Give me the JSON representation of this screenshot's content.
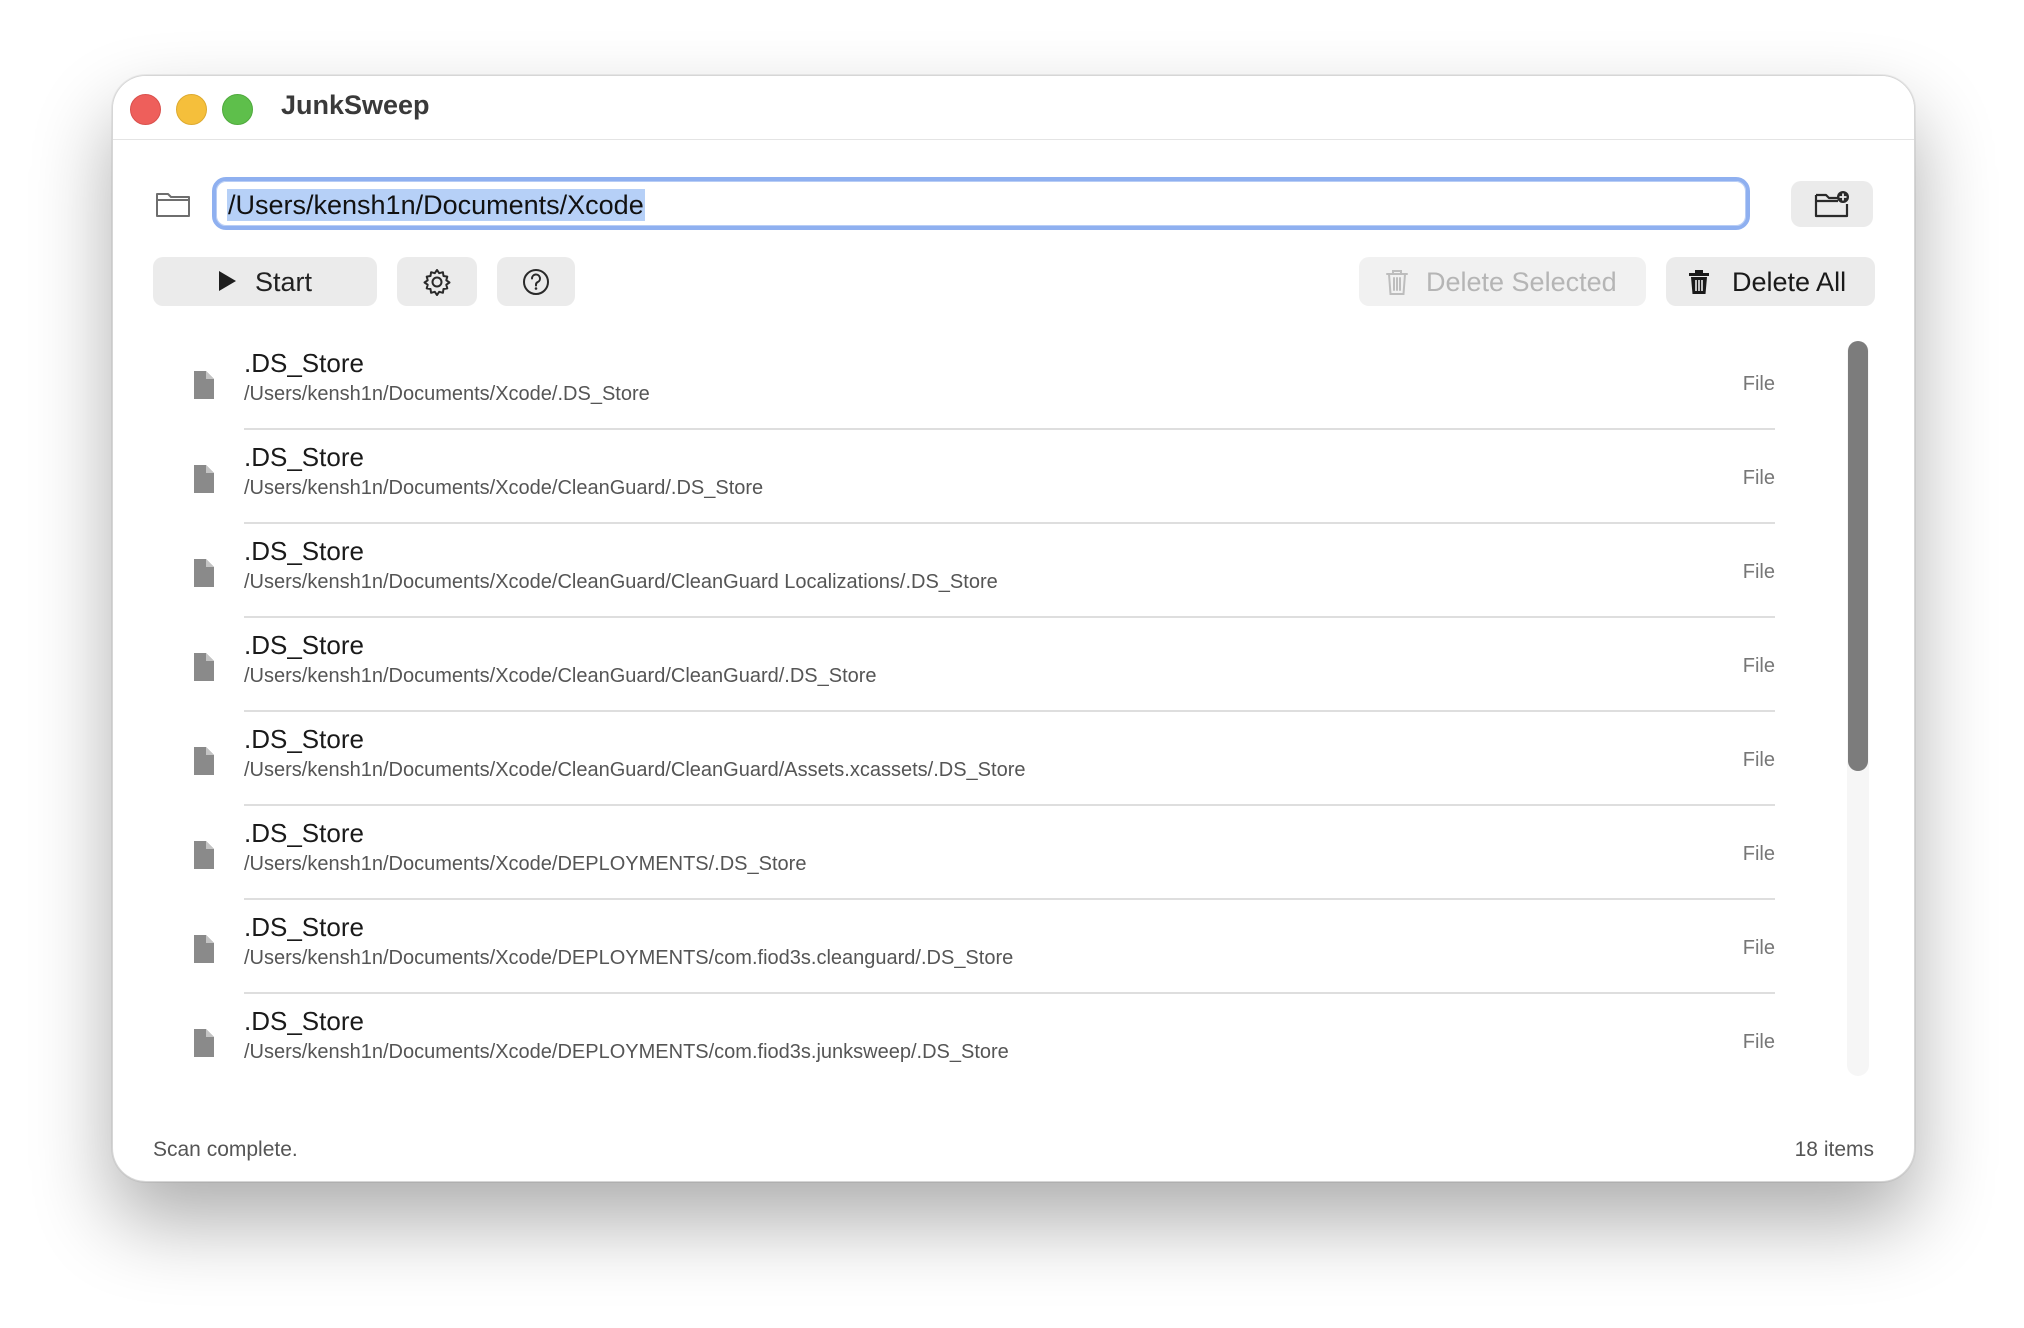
{
  "window": {
    "title": "JunkSweep"
  },
  "path_field": {
    "value": "/Users/kensh1n/Documents/Xcode"
  },
  "toolbar": {
    "start_label": "Start",
    "delete_selected_label": "Delete Selected",
    "delete_all_label": "Delete All"
  },
  "icons": {
    "folder": "folder-icon",
    "choose_folder": "folder-badge-plus-icon",
    "play": "play-icon",
    "settings": "gear-icon",
    "help": "question-circle-icon",
    "delete_selected": "trash-icon",
    "delete_all": "trash-fill-icon",
    "file": "doc-fill-icon"
  },
  "colors": {
    "selection": "#b6d0f7",
    "focus_ring": "#8fb0f0",
    "close": "#ee5f5b",
    "minimize": "#f5bf3b",
    "zoom": "#5ebf4b"
  },
  "items": [
    {
      "name": ".DS_Store",
      "path": "/Users/kensh1n/Documents/Xcode/.DS_Store",
      "kind": "File"
    },
    {
      "name": ".DS_Store",
      "path": "/Users/kensh1n/Documents/Xcode/CleanGuard/.DS_Store",
      "kind": "File"
    },
    {
      "name": ".DS_Store",
      "path": "/Users/kensh1n/Documents/Xcode/CleanGuard/CleanGuard Localizations/.DS_Store",
      "kind": "File"
    },
    {
      "name": ".DS_Store",
      "path": "/Users/kensh1n/Documents/Xcode/CleanGuard/CleanGuard/.DS_Store",
      "kind": "File"
    },
    {
      "name": ".DS_Store",
      "path": "/Users/kensh1n/Documents/Xcode/CleanGuard/CleanGuard/Assets.xcassets/.DS_Store",
      "kind": "File"
    },
    {
      "name": ".DS_Store",
      "path": "/Users/kensh1n/Documents/Xcode/DEPLOYMENTS/.DS_Store",
      "kind": "File"
    },
    {
      "name": ".DS_Store",
      "path": "/Users/kensh1n/Documents/Xcode/DEPLOYMENTS/com.fiod3s.cleanguard/.DS_Store",
      "kind": "File"
    },
    {
      "name": ".DS_Store",
      "path": "/Users/kensh1n/Documents/Xcode/DEPLOYMENTS/com.fiod3s.junksweep/.DS_Store",
      "kind": "File"
    }
  ],
  "status": {
    "message": "Scan complete.",
    "count": "18 items"
  }
}
